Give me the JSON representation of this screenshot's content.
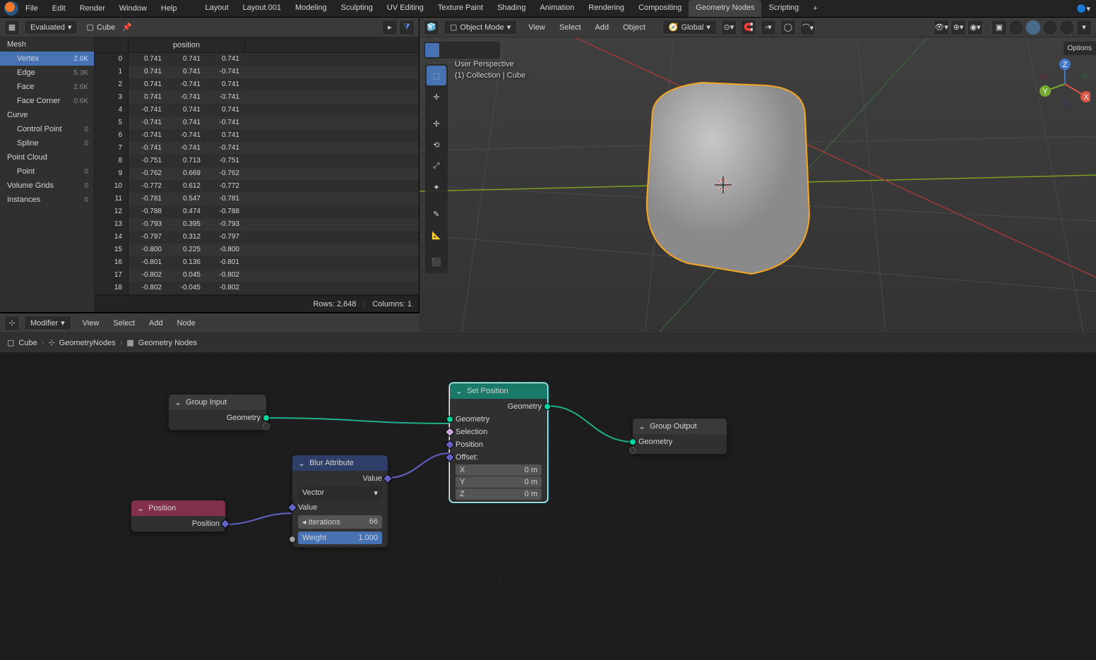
{
  "menus": [
    "File",
    "Edit",
    "Render",
    "Window",
    "Help"
  ],
  "workspaces": {
    "tabs": [
      "Layout",
      "Layout.001",
      "Modeling",
      "Sculpting",
      "UV Editing",
      "Texture Paint",
      "Shading",
      "Animation",
      "Rendering",
      "Compositing",
      "Geometry Nodes",
      "Scripting"
    ],
    "active": "Geometry Nodes",
    "add_tooltip": "+"
  },
  "spreadsheet": {
    "mode": "Evaluated",
    "object": "Cube",
    "sidebar": [
      {
        "label": "Mesh",
        "type": "header"
      },
      {
        "label": "Vertex",
        "count": "2.6K",
        "active": true
      },
      {
        "label": "Edge",
        "count": "5.3K"
      },
      {
        "label": "Face",
        "count": "2.6K"
      },
      {
        "label": "Face Corner",
        "count": "0.6K"
      },
      {
        "label": "Curve",
        "type": "header"
      },
      {
        "label": "Control Point",
        "count": "0"
      },
      {
        "label": "Spline",
        "count": "0"
      },
      {
        "label": "Point Cloud",
        "type": "header"
      },
      {
        "label": "Point",
        "count": "0"
      },
      {
        "label": "Volume Grids",
        "count": "0",
        "type": "header"
      },
      {
        "label": "Instances",
        "count": "0",
        "type": "header"
      }
    ],
    "column_header": "position",
    "rows": [
      [
        0,
        "0.741",
        "0.741",
        "0.741"
      ],
      [
        1,
        "0.741",
        "0.741",
        "-0.741"
      ],
      [
        2,
        "0.741",
        "-0.741",
        "0.741"
      ],
      [
        3,
        "0.741",
        "-0.741",
        "-0.741"
      ],
      [
        4,
        "-0.741",
        "0.741",
        "0.741"
      ],
      [
        5,
        "-0.741",
        "0.741",
        "-0.741"
      ],
      [
        6,
        "-0.741",
        "-0.741",
        "0.741"
      ],
      [
        7,
        "-0.741",
        "-0.741",
        "-0.741"
      ],
      [
        8,
        "-0.751",
        "0.713",
        "-0.751"
      ],
      [
        9,
        "-0.762",
        "0.669",
        "-0.762"
      ],
      [
        10,
        "-0.772",
        "0.612",
        "-0.772"
      ],
      [
        11,
        "-0.781",
        "0.547",
        "-0.781"
      ],
      [
        12,
        "-0.788",
        "0.474",
        "-0.788"
      ],
      [
        13,
        "-0.793",
        "0.395",
        "-0.793"
      ],
      [
        14,
        "-0.797",
        "0.312",
        "-0.797"
      ],
      [
        15,
        "-0.800",
        "0.225",
        "-0.800"
      ],
      [
        16,
        "-0.801",
        "0.136",
        "-0.801"
      ],
      [
        17,
        "-0.802",
        "0.045",
        "-0.802"
      ],
      [
        18,
        "-0.802",
        "-0.045",
        "-0.802"
      ]
    ],
    "footer_rows": "Rows: 2,648",
    "footer_cols": "Columns: 1"
  },
  "viewport": {
    "mode": "Object Mode",
    "menus": [
      "View",
      "Select",
      "Add",
      "Object"
    ],
    "orientation": "Global",
    "overlay_line1": "User Perspective",
    "overlay_line2": "(1) Collection | Cube",
    "options_tab": "Options"
  },
  "node_editor": {
    "panel_label": "Modifier",
    "menus": [
      "View",
      "Select",
      "Add",
      "Node"
    ],
    "datablock": "Geometry Nodes",
    "breadcrumb": [
      "Cube",
      "GeometryNodes",
      "Geometry Nodes"
    ],
    "nodes": {
      "group_input": {
        "title": "Group Input",
        "out": "Geometry"
      },
      "position": {
        "title": "Position",
        "out": "Position"
      },
      "blur": {
        "title": "Blur Attribute",
        "out": "Value",
        "type": "Vector",
        "in_value": "Value",
        "iterations_label": "Iterations",
        "iterations_val": "66",
        "weight_label": "Weight",
        "weight_val": "1.000"
      },
      "set_position": {
        "title": "Set Position",
        "out": "Geometry",
        "in_geom": "Geometry",
        "in_sel": "Selection",
        "in_pos": "Position",
        "offset_label": "Offset:",
        "ox": "X",
        "oy": "Y",
        "oz": "Z",
        "ov": "0 m"
      },
      "group_output": {
        "title": "Group Output",
        "in": "Geometry"
      }
    }
  }
}
